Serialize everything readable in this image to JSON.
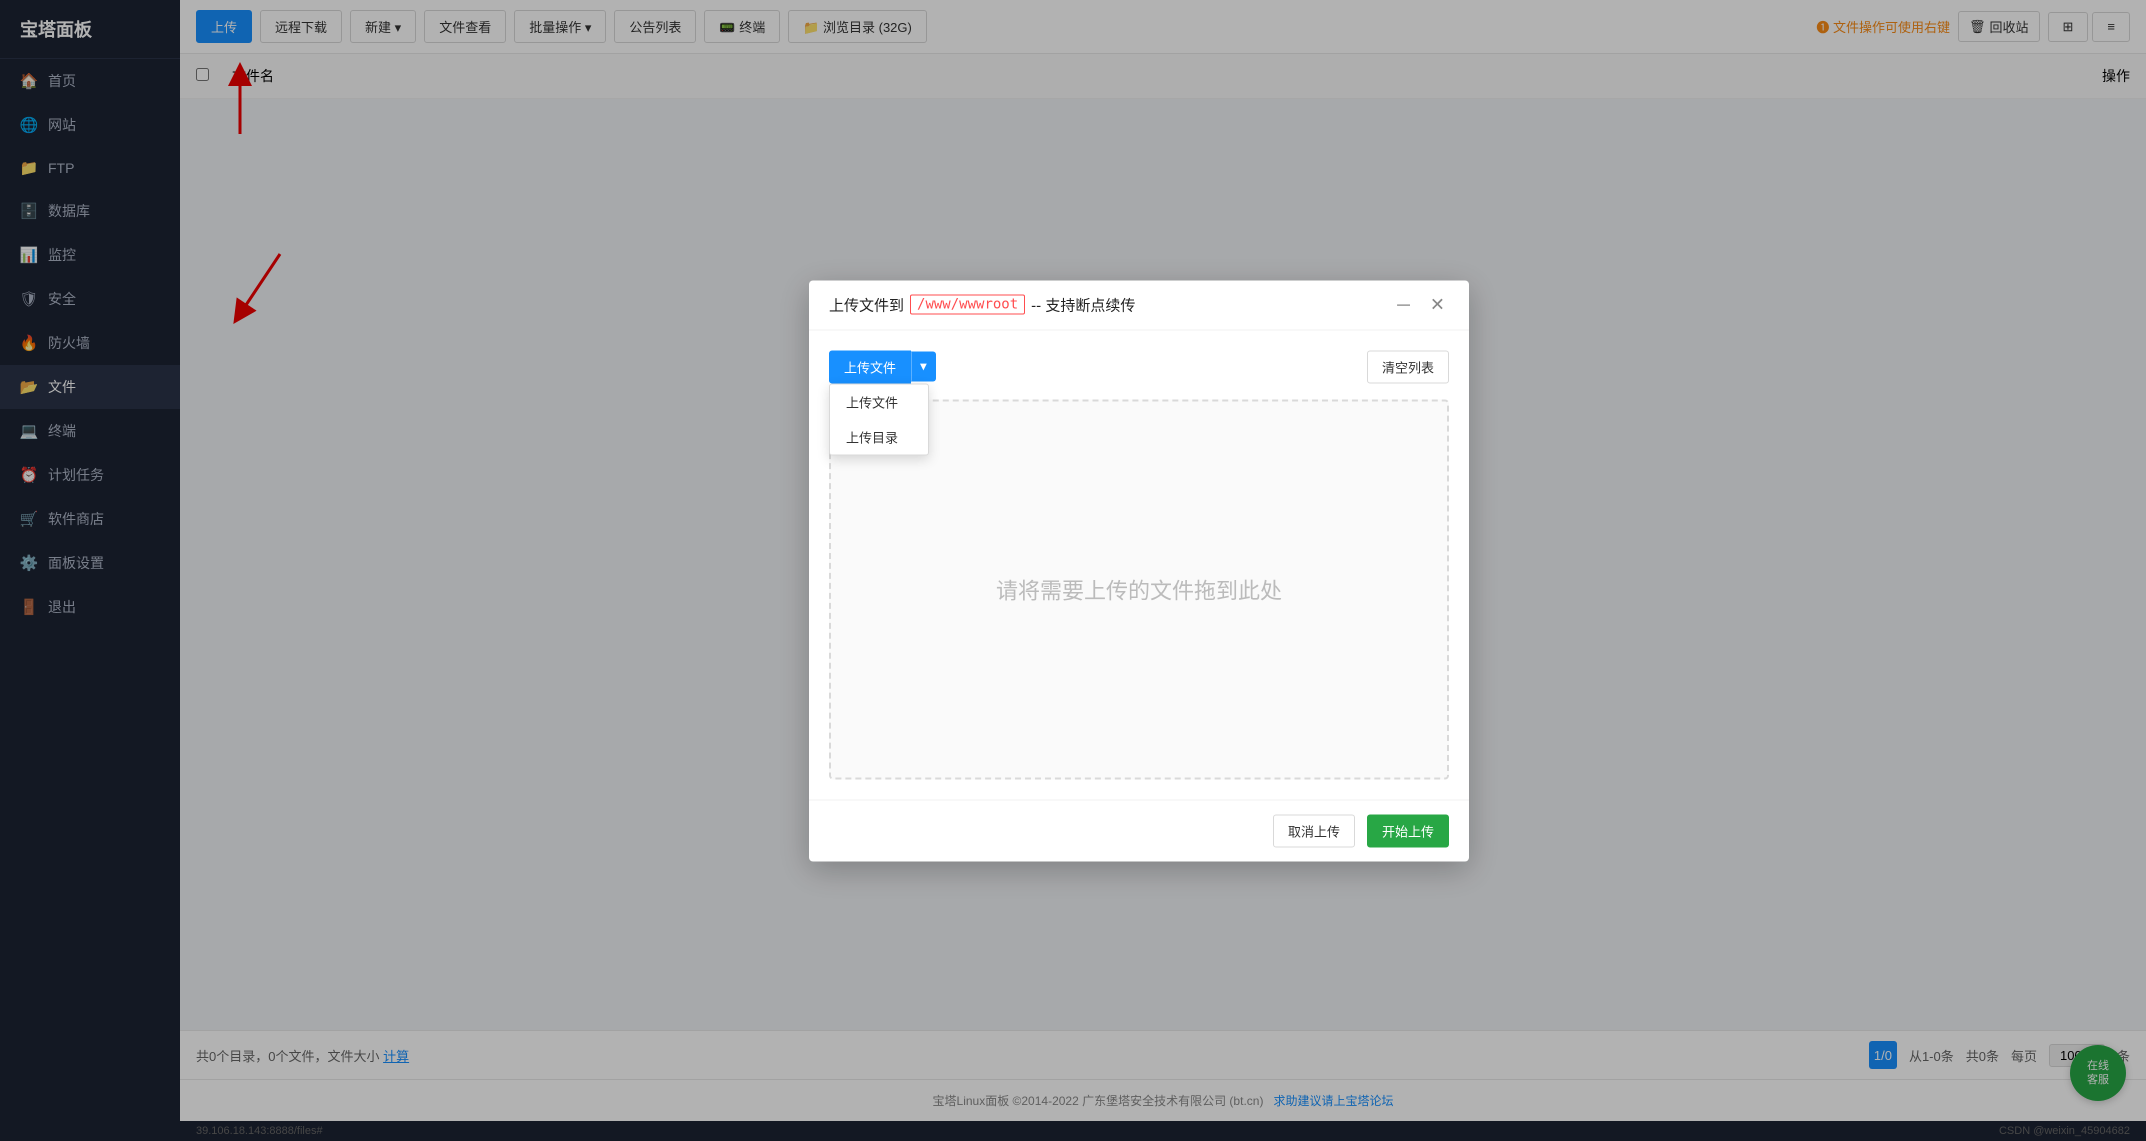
{
  "sidebar": {
    "items": [
      {
        "id": "home",
        "label": "首页",
        "icon": "🏠"
      },
      {
        "id": "website",
        "label": "网站",
        "icon": "🌐"
      },
      {
        "id": "ftp",
        "label": "FTP",
        "icon": "📁"
      },
      {
        "id": "database",
        "label": "数据库",
        "icon": "🗄️"
      },
      {
        "id": "monitor",
        "label": "监控",
        "icon": "📊"
      },
      {
        "id": "security",
        "label": "安全",
        "icon": "🛡"
      },
      {
        "id": "firewall",
        "label": "防火墙",
        "icon": "🔥"
      },
      {
        "id": "files",
        "label": "文件",
        "icon": "📂"
      },
      {
        "id": "terminal",
        "label": "终端",
        "icon": "💻"
      },
      {
        "id": "cron",
        "label": "计划任务",
        "icon": "⏰"
      },
      {
        "id": "appstore",
        "label": "软件商店",
        "icon": "🛒"
      },
      {
        "id": "panel",
        "label": "面板设置",
        "icon": "⚙️"
      },
      {
        "id": "logout",
        "label": "退出",
        "icon": "🚪"
      }
    ]
  },
  "toolbar": {
    "upload_label": "上传",
    "remote_download_label": "远程下载",
    "new_label": "新建",
    "file_list_label": "文件查看",
    "batch_ops_label": "批量操作",
    "public_list_label": "公告列表",
    "terminal_label": "终端",
    "browser_label": "浏览目录 (32G)",
    "file_ops_hint": "❶ 文件操作可使用右键",
    "trash_label": "回收站",
    "view_grid_icon": "⊞",
    "view_list_icon": "≡"
  },
  "file_table": {
    "col_name": "文件名",
    "col_action": "操作"
  },
  "status_bar": {
    "summary": "共0个目录，0个文件，文件大小",
    "calc_link": "计算",
    "page_info": "1/0",
    "range_info": "从1-0条",
    "total_info": "共0条",
    "per_page_label": "每页",
    "per_page_value": "100",
    "per_page_unit": "条"
  },
  "modal": {
    "title_prefix": "上传文件到",
    "path": "/www/wwwroot",
    "title_suffix": "-- 支持断点续传",
    "upload_btn_label": "上传文件",
    "clear_btn_label": "清空列表",
    "drop_hint": "请将需要上传的文件拖到此处",
    "cancel_btn_label": "取消上传",
    "start_btn_label": "开始上传",
    "dropdown_menu": [
      {
        "label": "上传文件"
      },
      {
        "label": "上传目录"
      }
    ]
  },
  "online_service": {
    "line1": "在线",
    "line2": "客服"
  },
  "footer": {
    "text": "宝塔Linux面板 ©2014-2022 广东堡塔安全技术有限公司 (bt.cn)",
    "link_text": "求助建议请上宝塔论坛"
  },
  "bottom_bar": {
    "url": "39.106.18.143:8888/files#",
    "user": "CSDN @weixin_45904682"
  }
}
